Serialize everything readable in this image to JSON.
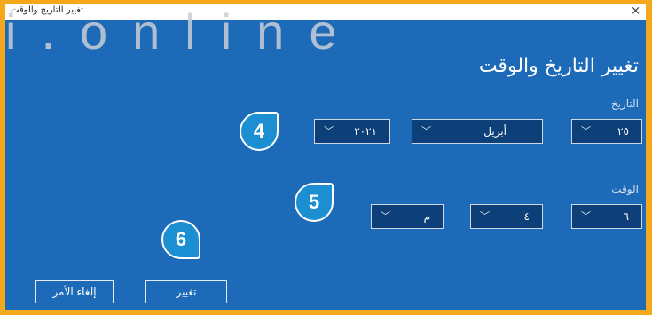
{
  "window": {
    "title": "تغيير التاريخ والوقت",
    "close_glyph": "×",
    "watermark": "i.online"
  },
  "heading": "تغيير التاريخ والوقت",
  "date": {
    "label": "التاريخ",
    "day": "٢٥",
    "month": "أبريل",
    "year": "٢٠٢١"
  },
  "time": {
    "label": "الوقت",
    "hour": "٦",
    "minute": "٤",
    "period": "م"
  },
  "buttons": {
    "change": "تغيير",
    "cancel": "إلغاء الأمر"
  },
  "callouts": {
    "one": "4",
    "two": "5",
    "three": "6"
  },
  "icons": {
    "chevron": "﹀"
  },
  "colors": {
    "frame": "#f5a81c",
    "panel": "#1d6bb8",
    "dropdown": "#0d3f78",
    "badge": "#1b8fd2"
  }
}
